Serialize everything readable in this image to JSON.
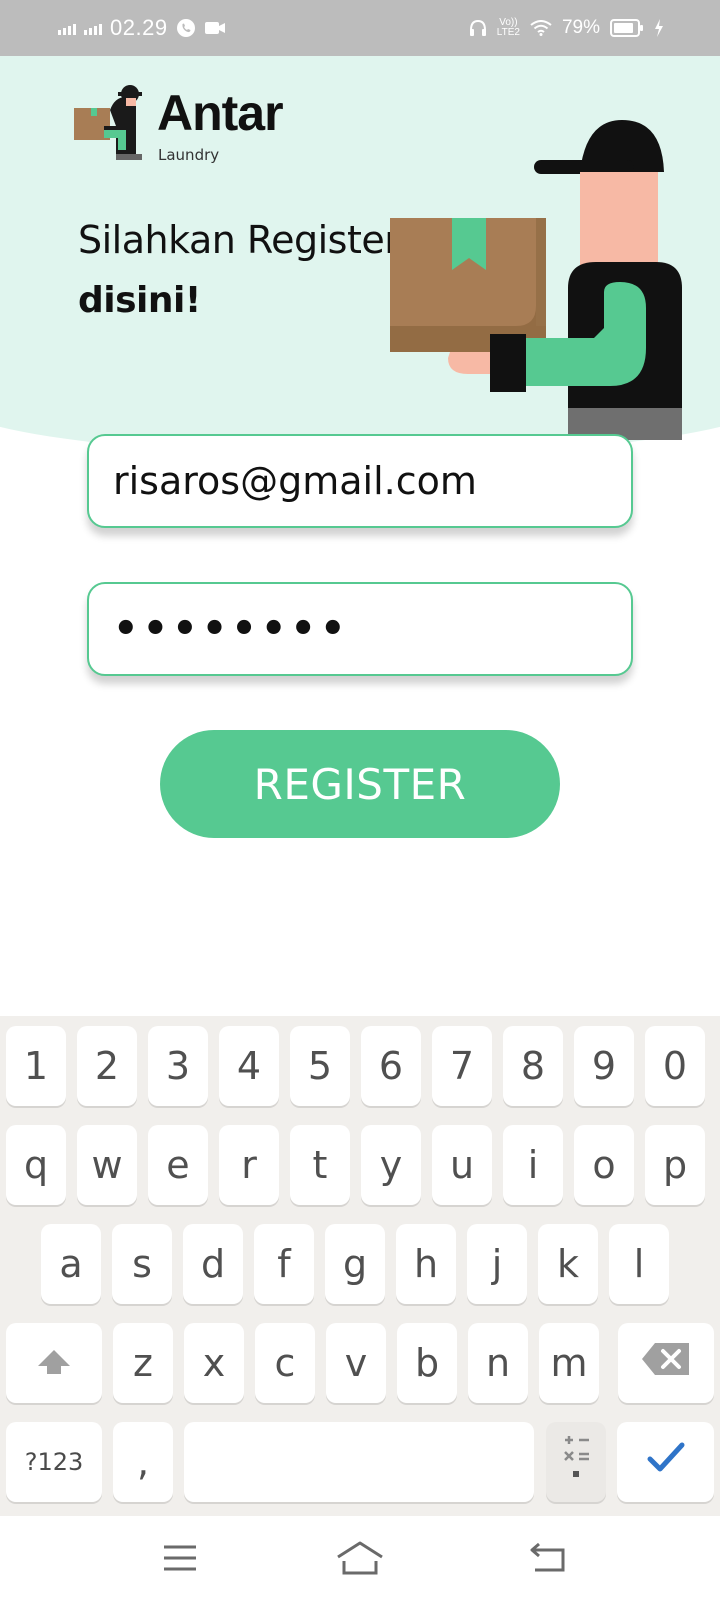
{
  "status_bar": {
    "time": "02.29",
    "network_label_top": "Vo))",
    "network_label_bottom": "LTE2",
    "battery_percent": "79%",
    "icons": [
      "signal-icon",
      "signal-icon",
      "whatsapp-call-icon",
      "video-icon",
      "headphones-icon",
      "volte-icon",
      "wifi-icon",
      "battery-icon",
      "charging-icon"
    ]
  },
  "header": {
    "logo_name": "Antar",
    "logo_sub": "Laundry",
    "greeting_line1": "Silahkan Register,",
    "greeting_line2": "disini!",
    "background_color": "#e0f5ee"
  },
  "form": {
    "email_value": "risaros@gmail.com",
    "password_value": "••••••••",
    "register_label": "REGISTER",
    "accent_color": "#56c991"
  },
  "keyboard": {
    "row_numbers": [
      "1",
      "2",
      "3",
      "4",
      "5",
      "6",
      "7",
      "8",
      "9",
      "0"
    ],
    "row_top": [
      "q",
      "w",
      "e",
      "r",
      "t",
      "y",
      "u",
      "i",
      "o",
      "p"
    ],
    "row_middle": [
      "a",
      "s",
      "d",
      "f",
      "g",
      "h",
      "j",
      "k",
      "l"
    ],
    "row_bottom": [
      "z",
      "x",
      "c",
      "v",
      "b",
      "n",
      "m"
    ],
    "symbols_label": "?123",
    "comma_label": ","
  },
  "navbar": {
    "icons": [
      "menu-icon",
      "home-icon",
      "back-icon"
    ]
  }
}
